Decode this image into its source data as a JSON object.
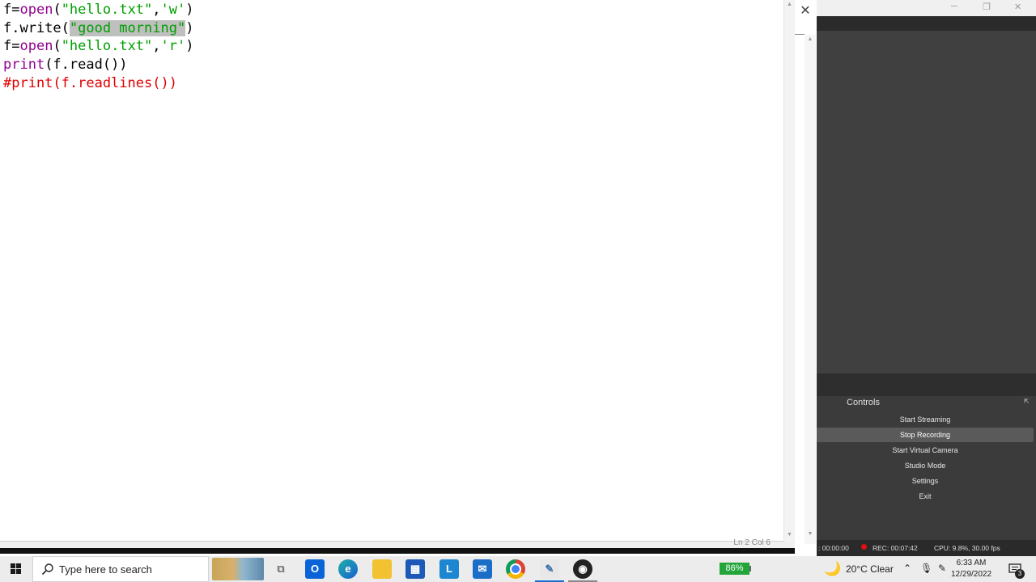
{
  "editor": {
    "lines": [
      [
        {
          "t": "f=",
          "c": "df"
        },
        {
          "t": "open",
          "c": "kw"
        },
        {
          "t": "(",
          "c": "df"
        },
        {
          "t": "\"hello.txt\"",
          "c": "str"
        },
        {
          "t": ",",
          "c": "df"
        },
        {
          "t": "'w'",
          "c": "str"
        },
        {
          "t": ")",
          "c": "df"
        }
      ],
      [
        {
          "t": "f.write(",
          "c": "df"
        },
        {
          "t": "\"good morning\"",
          "c": "str",
          "sel": true
        },
        {
          "t": ")",
          "c": "df"
        }
      ],
      [
        {
          "t": "f=",
          "c": "df"
        },
        {
          "t": "open",
          "c": "kw"
        },
        {
          "t": "(",
          "c": "df"
        },
        {
          "t": "\"hello.txt\"",
          "c": "str"
        },
        {
          "t": ",",
          "c": "df"
        },
        {
          "t": "'r'",
          "c": "str"
        },
        {
          "t": ")",
          "c": "df"
        }
      ],
      [
        {
          "t": "print",
          "c": "kw"
        },
        {
          "t": "(f.read())",
          "c": "df"
        }
      ],
      [
        {
          "t": "#print(f.readlines())",
          "c": "cm"
        }
      ]
    ],
    "status": "Ln 2  Col 6"
  },
  "obs": {
    "controls_title": "Controls",
    "buttons": [
      {
        "label": "Start Streaming",
        "active": false
      },
      {
        "label": "Stop Recording",
        "active": true
      },
      {
        "label": "Start Virtual Camera",
        "active": false
      },
      {
        "label": "Studio Mode",
        "active": false
      },
      {
        "label": "Settings",
        "active": false
      },
      {
        "label": "Exit",
        "active": false
      }
    ],
    "status": {
      "live": ": 00:00:00",
      "rec": "REC: 00:07:42",
      "cpu": "CPU: 9.8%, 30.00 fps"
    }
  },
  "taskbar": {
    "search_placeholder": "Type here to search",
    "battery": "86%",
    "weather": "20°C  Clear",
    "time": "6:33 AM",
    "date": "12/29/2022",
    "notification_count": "3"
  }
}
